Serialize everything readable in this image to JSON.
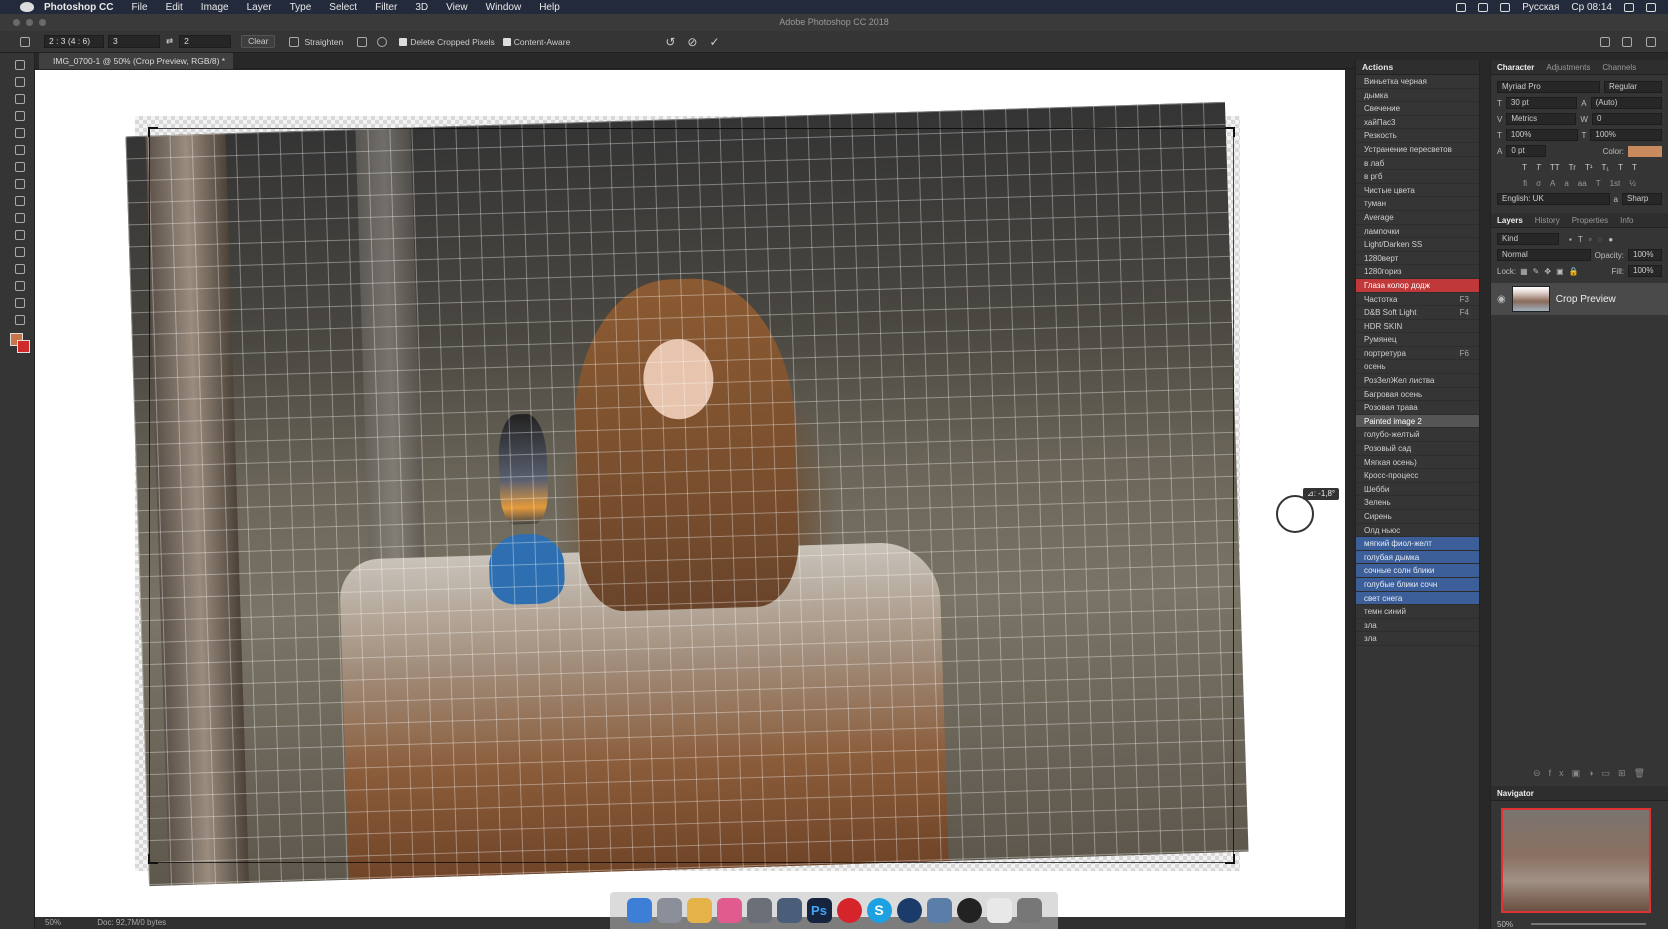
{
  "menubar": {
    "app": "Photoshop CC",
    "items": [
      "File",
      "Edit",
      "Image",
      "Layer",
      "Type",
      "Select",
      "Filter",
      "3D",
      "View",
      "Window",
      "Help"
    ],
    "lang": "Русская",
    "clock": "Ср 08:14"
  },
  "window": {
    "title": "Adobe Photoshop CC 2018"
  },
  "options": {
    "ratio": "2 : 3 (4 : 6)",
    "width": "3",
    "height": "2",
    "clear": "Clear",
    "straighten": "Straighten",
    "delete_cropped": "Delete Cropped Pixels",
    "content_aware": "Content-Aware"
  },
  "document": {
    "tab": "IMG_0700-1 @ 50% (Crop Preview, RGB/8) *",
    "rotation_readout": "⊿: -1,8°"
  },
  "status": {
    "zoom": "50%",
    "doc": "Doc: 92,7M/0 bytes"
  },
  "actions": {
    "title": "Actions",
    "items": [
      {
        "label": "Виньетка черная",
        "key": "",
        "state": ""
      },
      {
        "label": "дымка",
        "key": "",
        "state": ""
      },
      {
        "label": "Свечение",
        "key": "",
        "state": ""
      },
      {
        "label": "хайПас3",
        "key": "",
        "state": ""
      },
      {
        "label": "Резкость",
        "key": "",
        "state": ""
      },
      {
        "label": "Устранение пересветов",
        "key": "",
        "state": ""
      },
      {
        "label": "в лаб",
        "key": "",
        "state": ""
      },
      {
        "label": "в ргб",
        "key": "",
        "state": ""
      },
      {
        "label": "Чистые цвета",
        "key": "",
        "state": ""
      },
      {
        "label": "туман",
        "key": "",
        "state": ""
      },
      {
        "label": "Average",
        "key": "",
        "state": ""
      },
      {
        "label": "лампочки",
        "key": "",
        "state": ""
      },
      {
        "label": "Light/Darken SS",
        "key": "",
        "state": ""
      },
      {
        "label": "1280верт",
        "key": "",
        "state": ""
      },
      {
        "label": "1280гориз",
        "key": "",
        "state": ""
      },
      {
        "label": "Глаза колор додж",
        "key": "",
        "state": "red"
      },
      {
        "label": "Частотка",
        "key": "F3",
        "state": ""
      },
      {
        "label": "D&B Soft Light",
        "key": "F4",
        "state": ""
      },
      {
        "label": "HDR SKIN",
        "key": "",
        "state": ""
      },
      {
        "label": "Румянец",
        "key": "",
        "state": ""
      },
      {
        "label": "портретура",
        "key": "F6",
        "state": ""
      },
      {
        "label": "осень",
        "key": "",
        "state": ""
      },
      {
        "label": "РозЗелЖел листва",
        "key": "",
        "state": ""
      },
      {
        "label": "Багровая осень",
        "key": "",
        "state": ""
      },
      {
        "label": "Розовая трава",
        "key": "",
        "state": ""
      },
      {
        "label": "Painted image 2",
        "key": "",
        "state": "sel"
      },
      {
        "label": "голубо-желтый",
        "key": "",
        "state": ""
      },
      {
        "label": "Розовый сад",
        "key": "",
        "state": ""
      },
      {
        "label": "Мягкая осень)",
        "key": "",
        "state": ""
      },
      {
        "label": "Кросс-процесс",
        "key": "",
        "state": ""
      },
      {
        "label": "Шебби",
        "key": "",
        "state": ""
      },
      {
        "label": "Зелень",
        "key": "",
        "state": ""
      },
      {
        "label": "Сирень",
        "key": "",
        "state": ""
      },
      {
        "label": "Олд ньюс",
        "key": "",
        "state": ""
      },
      {
        "label": "мягкий фиол-желт",
        "key": "",
        "state": "blue"
      },
      {
        "label": "голубая дымка",
        "key": "",
        "state": "blue"
      },
      {
        "label": "сочные солн блики",
        "key": "",
        "state": "blue"
      },
      {
        "label": "голубые блики сочн",
        "key": "",
        "state": "blue"
      },
      {
        "label": "свет снега",
        "key": "",
        "state": "blue"
      },
      {
        "label": "темн синий",
        "key": "",
        "state": ""
      },
      {
        "label": "зла",
        "key": "",
        "state": ""
      },
      {
        "label": "зла",
        "key": "",
        "state": ""
      }
    ]
  },
  "character": {
    "tabs": [
      "Character",
      "Adjustments",
      "Channels"
    ],
    "font": "Myriad Pro",
    "style": "Regular",
    "size": "30 pt",
    "leading": "(Auto)",
    "kerning": "Metrics",
    "tracking": "0",
    "vscale": "100%",
    "hscale": "100%",
    "baseline": "0 pt",
    "color_label": "Color:",
    "color": "#c98a5e",
    "language": "English: UK",
    "aa": "Sharp"
  },
  "layers": {
    "tabs": [
      "Layers",
      "History",
      "Properties",
      "Info"
    ],
    "kind": "Kind",
    "blend": "Normal",
    "opacity_label": "Opacity:",
    "opacity": "100%",
    "lock_label": "Lock:",
    "fill_label": "Fill:",
    "fill": "100%",
    "layer_name": "Crop Preview"
  },
  "navigator": {
    "title": "Navigator",
    "zoom": "50%"
  }
}
